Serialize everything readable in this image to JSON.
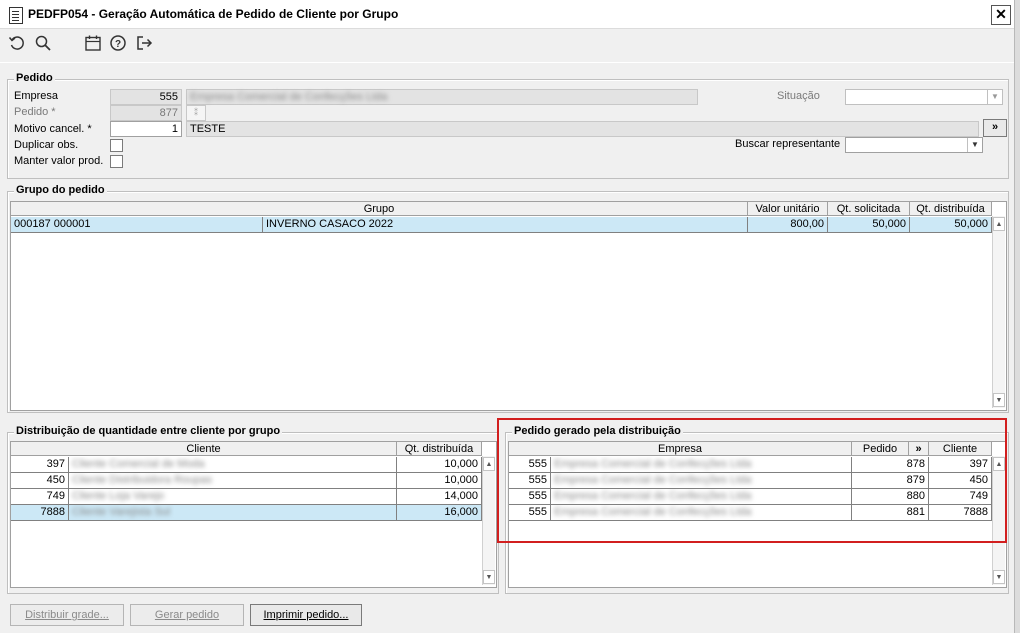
{
  "window": {
    "title": "PEDFP054 - Geração Automática de Pedido de Cliente por Grupo",
    "close": "✕"
  },
  "toolbar": {
    "icons": [
      "undo-icon",
      "search-icon",
      "calendar-icon",
      "help-icon",
      "exit-icon"
    ]
  },
  "pedido": {
    "title": "Pedido",
    "empresa_label": "Empresa",
    "empresa_value": "555",
    "empresa_name": "Empresa Comercial de Confecções Ltda",
    "pedido_label": "Pedido *",
    "pedido_value": "877",
    "motivo_label": "Motivo cancel. *",
    "motivo_value": "1",
    "motivo_desc": "TESTE",
    "motivo_btn": "»",
    "duplicar_label": "Duplicar obs.",
    "manter_label": "Manter valor prod.",
    "situacao_label": "Situação",
    "situacao_value": "",
    "buscar_label": "Buscar representante",
    "buscar_value": ""
  },
  "grupo": {
    "title": "Grupo do pedido",
    "headers": [
      "Grupo",
      "Valor unitário",
      "Qt. solicitada",
      "Qt. distribuída"
    ],
    "rows": [
      {
        "codigo": "000187 000001",
        "descricao": "INVERNO CASACO 2022",
        "valor": "800,00",
        "qt_sol": "50,000",
        "qt_dist": "50,000"
      }
    ]
  },
  "distribuicao": {
    "title": "Distribuição de quantidade entre cliente por grupo",
    "headers": [
      "Cliente",
      "Qt. distribuída"
    ],
    "rows": [
      {
        "cliente": "397",
        "nome": "Cliente Comercial de Moda",
        "qt": "10,000"
      },
      {
        "cliente": "450",
        "nome": "Cliente Distribuidora Roupas",
        "qt": "10,000"
      },
      {
        "cliente": "749",
        "nome": "Cliente Loja Varejo",
        "qt": "14,000"
      },
      {
        "cliente": "7888",
        "nome": "Cliente Varejista Sul",
        "qt": "16,000"
      }
    ]
  },
  "gerado": {
    "title": "Pedido gerado pela distribuição",
    "headers": [
      "Empresa",
      "Pedido",
      "»",
      "Cliente"
    ],
    "rows": [
      {
        "empresa": "555",
        "nome": "Empresa Comercial de Confecções Ltda",
        "pedido": "878",
        "cliente": "397"
      },
      {
        "empresa": "555",
        "nome": "Empresa Comercial de Confecções Ltda",
        "pedido": "879",
        "cliente": "450"
      },
      {
        "empresa": "555",
        "nome": "Empresa Comercial de Confecções Ltda",
        "pedido": "880",
        "cliente": "749"
      },
      {
        "empresa": "555",
        "nome": "Empresa Comercial de Confecções Ltda",
        "pedido": "881",
        "cliente": "7888"
      }
    ]
  },
  "buttons": {
    "distribuir": "Distribuir grade...",
    "gerar": "Gerar pedido",
    "imprimir": "Imprimir pedido..."
  },
  "colors": {
    "selection": "#cce8f6",
    "highlight": "#d21f1f"
  }
}
